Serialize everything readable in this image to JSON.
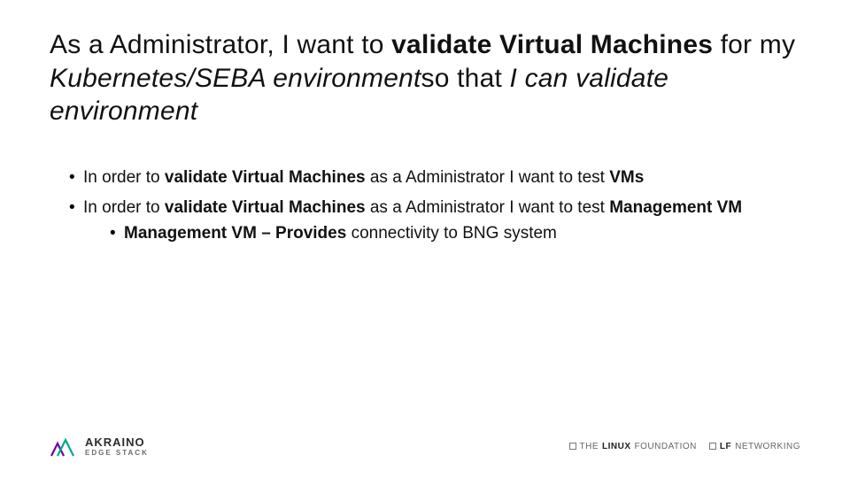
{
  "title": {
    "seg1": "As a Administrator, I want to ",
    "seg2_bold": "validate Virtual Machines",
    "seg3": " for my ",
    "seg4_ital": "Kubernetes/SEBA environment",
    "seg5": "so that ",
    "seg6_ital": "I can validate environment"
  },
  "bullets": {
    "b1": {
      "p1": "In order to ",
      "p2_bold": "validate Virtual Machines",
      "p3": " as a Administrator I want to test ",
      "p4_bold": "VMs"
    },
    "b2": {
      "p1": "In order to ",
      "p2_bold": "validate Virtual Machines",
      "p3": " as a Administrator I want to test ",
      "p4_bold": "Management VM"
    },
    "b2a": {
      "p1_bold": "Management VM – Provides",
      "p2": " connectivity to BNG system"
    }
  },
  "logos": {
    "akraino_top": "AKRAINO",
    "akraino_bottom": "EDGE STACK",
    "lf_thin": "THE",
    "lf_bold": "LINUX",
    "lf_tail": "FOUNDATION",
    "lfn_bold": "LF",
    "lfn_tail": "NETWORKING"
  }
}
